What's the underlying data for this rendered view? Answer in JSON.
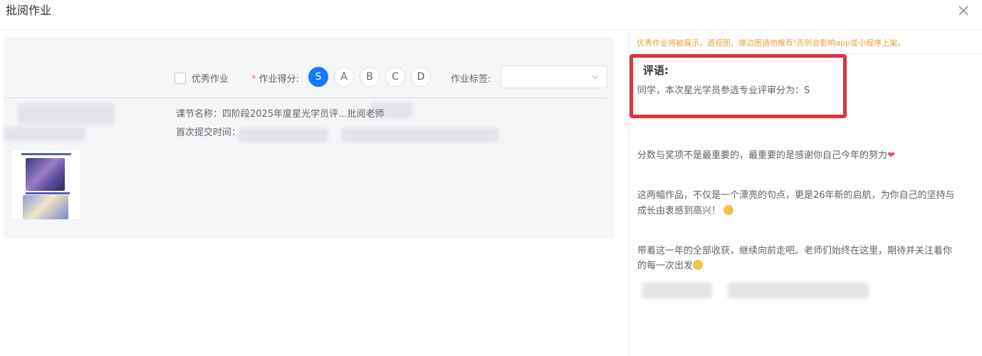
{
  "dialog": {
    "title": "批阅作业"
  },
  "score_bar": {
    "excellent_label": "优秀作业",
    "excellent_checked": false,
    "score_required_mark": "*",
    "score_label": "作业得分:",
    "grades": [
      "S",
      "A",
      "B",
      "C",
      "D"
    ],
    "selected_grade": "S",
    "tag_label": "作业标签:",
    "tag_value": ""
  },
  "lesson": {
    "name_line": "课节名称：四阶段2025年度星光学员评...批阅老师",
    "submit_time_label": "首次提交时间："
  },
  "right": {
    "notice": "优秀作业将被展示，透视图、擦边图请勿推荐!否则会影响app或小程序上架。",
    "comment_title": "评语:",
    "line1": "同学，本次星光学员参选专业评审分为：S",
    "line2": "分数与奖项不是最重要的，最重要的是感谢你自己今年的努力",
    "line3a": "这两幅作品，不仅是一个漂亮的句点，更是26年新的启航，为你自己的坚持与",
    "line3b": "成长由衷感到高兴！",
    "line4a": "带着这一年的全部收获，继续向前走吧。老师们始终在这里，期待并关注着你",
    "line4b": "的每一次出发"
  },
  "icons": {
    "close": "close-icon",
    "dropdown": "chevron-down-icon",
    "heart": "heart-emoji",
    "clap": "clap-emoji",
    "smile": "smile-emoji"
  },
  "colors": {
    "accent": "#1677ff",
    "notice": "#e6a23c",
    "highlight": "#d9343f",
    "required": "#f56c6c"
  }
}
